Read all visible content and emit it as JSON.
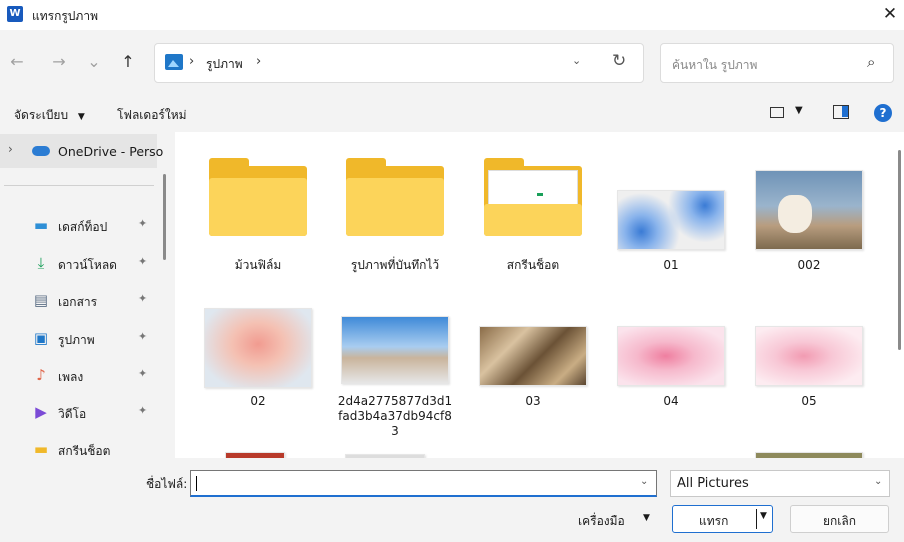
{
  "window": {
    "app_icon_letter": "W",
    "title": "แทรกรูปภาพ",
    "close_glyph": "✕"
  },
  "nav": {
    "back_glyph": "←",
    "forward_glyph": "→",
    "recent_glyph": "⌄",
    "up_glyph": "↑"
  },
  "address": {
    "separator": "›",
    "crumb": "รูปภาพ",
    "dropdown_glyph": "⌄",
    "refresh_glyph": "↻"
  },
  "search": {
    "placeholder": "ค้นหาใน รูปภาพ",
    "icon_glyph": "⌕"
  },
  "toolbar": {
    "organize_label": "จัดระเบียบ",
    "organize_caret": "▼",
    "new_folder_label": "โฟลเดอร์ใหม่",
    "view_caret": "▼",
    "help_glyph": "?"
  },
  "sidebar": {
    "onedrive_chevron": "›",
    "onedrive_label": "OneDrive - Perso",
    "pin_glyph": "✦",
    "items": [
      {
        "label": "เดสก์ท็อป",
        "icon": "desktop-icon",
        "glyph": "▬",
        "color": "#2e8fd6"
      },
      {
        "label": "ดาวน์โหลด",
        "icon": "download-icon",
        "glyph": "⤓",
        "color": "#1a9e5a"
      },
      {
        "label": "เอกสาร",
        "icon": "document-icon",
        "glyph": "▤",
        "color": "#5c6f86"
      },
      {
        "label": "รูปภาพ",
        "icon": "pictures-icon",
        "glyph": "▣",
        "color": "#1f77c8"
      },
      {
        "label": "เพลง",
        "icon": "music-icon",
        "glyph": "♪",
        "color": "#e0664a"
      },
      {
        "label": "วิดีโอ",
        "icon": "video-icon",
        "glyph": "▶",
        "color": "#7b4bd6"
      },
      {
        "label": "สกรีนช็อต",
        "icon": "folder-icon",
        "glyph": "▬",
        "color": "#f0b82a"
      }
    ]
  },
  "files": [
    {
      "name": "ม้วนฟิล์ม",
      "type": "folder"
    },
    {
      "name": "รูปภาพที่บันทึกไว้",
      "type": "folder"
    },
    {
      "name": "สกรีนช็อต",
      "type": "folder-with-preview"
    },
    {
      "name": "01",
      "type": "image"
    },
    {
      "name": "002",
      "type": "image"
    },
    {
      "name": "02",
      "type": "image"
    },
    {
      "name": "2d4a2775877d3d1fad3b4a37db94cf83",
      "type": "image"
    },
    {
      "name": "03",
      "type": "image"
    },
    {
      "name": "04",
      "type": "image"
    },
    {
      "name": "05",
      "type": "image"
    }
  ],
  "footer": {
    "filename_label": "ชื่อไฟล์:",
    "filename_value": "",
    "filename_caret": "⌄",
    "filter_value": "All Pictures",
    "filter_caret": "⌄",
    "tools_label": "เครื่องมือ",
    "tools_caret": "▼",
    "insert_label": "แทรก",
    "insert_caret": "▼",
    "cancel_label": "ยกเลิก"
  },
  "colors": {
    "accent": "#1f6fd0",
    "folder": "#f0b82a"
  }
}
